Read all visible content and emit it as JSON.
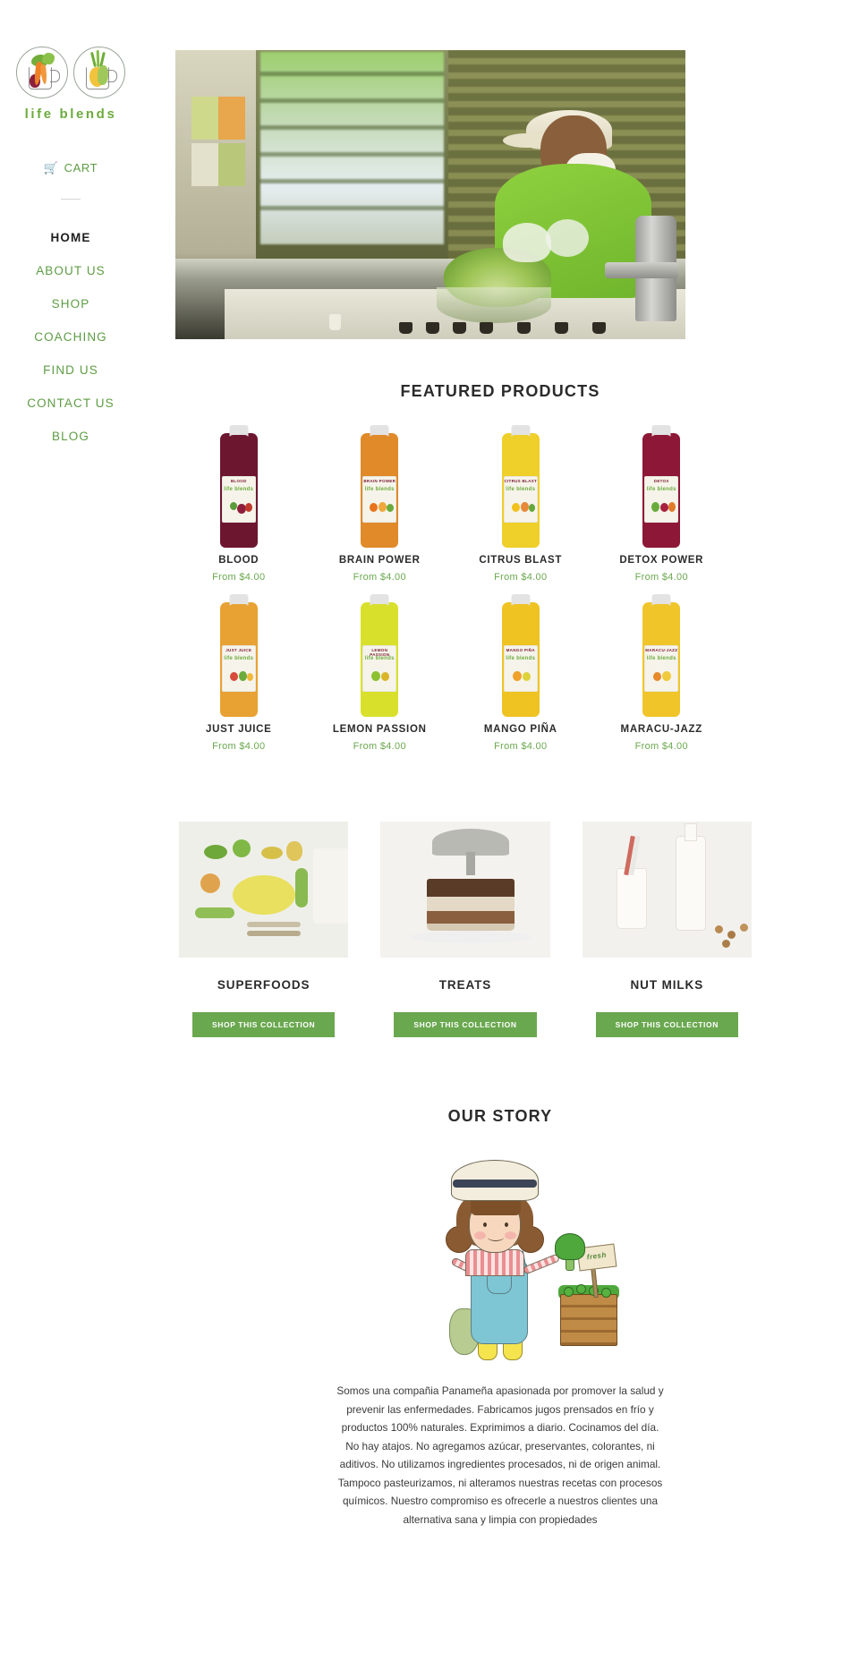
{
  "brand": {
    "name": "life blends",
    "logo_icons": [
      "carrot-jug-icon",
      "pineapple-jug-icon"
    ]
  },
  "sidebar": {
    "cart": {
      "label": "CART",
      "icon": "shopping-cart-icon"
    },
    "nav": [
      {
        "label": "HOME",
        "active": true
      },
      {
        "label": "ABOUT US",
        "active": false
      },
      {
        "label": "SHOP",
        "active": false
      },
      {
        "label": "COACHING",
        "active": false
      },
      {
        "label": "FIND US",
        "active": false
      },
      {
        "label": "CONTACT US",
        "active": false
      },
      {
        "label": "BLOG",
        "active": false
      }
    ]
  },
  "hero": {
    "alt": "juice-production-worker-photo"
  },
  "featured": {
    "title": "FEATURED PRODUCTS",
    "products": [
      {
        "name": "BLOOD",
        "price": "From $4.00",
        "juice": "#6d1630",
        "label_top": "BLOOD"
      },
      {
        "name": "BRAIN POWER",
        "price": "From $4.00",
        "juice": "#e08a2a",
        "label_top": "BRAIN POWER"
      },
      {
        "name": "CITRUS BLAST",
        "price": "From $4.00",
        "juice": "#efcf2a",
        "label_top": "CITRUS BLAST"
      },
      {
        "name": "DETOX POWER",
        "price": "From $4.00",
        "juice": "#8d1736",
        "label_top": "DETOX"
      },
      {
        "name": "JUST JUICE",
        "price": "From $4.00",
        "juice": "#e8a233",
        "label_top": "JUST JUICE"
      },
      {
        "name": "LEMON PASSION",
        "price": "From $4.00",
        "juice": "#d9e02c",
        "label_top": "LEMON PASSION"
      },
      {
        "name": "MANGO PIÑA",
        "price": "From $4.00",
        "juice": "#efc322",
        "label_top": "MANGO PIÑA"
      },
      {
        "name": "MARACU-JAZZ",
        "price": "From $4.00",
        "juice": "#f0c52a",
        "label_top": "MARACU-JAZZ"
      }
    ]
  },
  "collections": [
    {
      "title": "SUPERFOODS",
      "button": "SHOP THIS COLLECTION",
      "image": "vegetable-flatlay-photo"
    },
    {
      "title": "TREATS",
      "button": "SHOP THIS COLLECTION",
      "image": "cocoa-cake-photo"
    },
    {
      "title": "NUT MILKS",
      "button": "SHOP THIS COLLECTION",
      "image": "nut-milk-bottle-photo"
    }
  ],
  "story": {
    "title": "OUR STORY",
    "illustration": "girl-farmer-illustration",
    "sign_text": "fresh",
    "text": "Somos una compañia Panameña apasionada por promover la salud y prevenir las enfermedades. Fabricamos jugos prensados en frío y productos 100% naturales. Exprimimos a diario. Cocinamos del día. No hay atajos. No agregamos azúcar, preservantes, colorantes, ni aditivos. No utilizamos ingredientes procesados, ni de origen animal. Tampoco pasteurizamos, ni alteramos nuestras recetas con procesos químicos. Nuestro compromiso es ofrecerle a nuestros clientes una alternativa sana y limpia con propiedades"
  },
  "colors": {
    "green": "#6aa84f",
    "nav_green": "#5d9c43",
    "dark": "#2b2b2b"
  }
}
